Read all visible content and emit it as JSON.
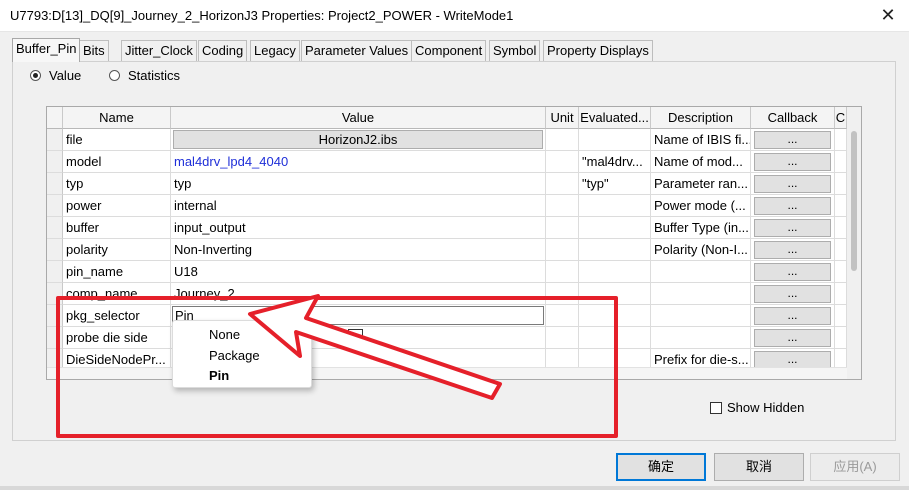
{
  "window": {
    "title": "U7793:D[13]_DQ[9]_Journey_2_HorizonJ3 Properties: Project2_POWER - WriteMode1",
    "close_icon": "close-icon"
  },
  "tabs": [
    {
      "label": "Buffer_Pin",
      "active": true
    },
    {
      "label": "Bits"
    },
    {
      "label": "Jitter_Clock"
    },
    {
      "label": "Coding"
    },
    {
      "label": "Legacy"
    },
    {
      "label": "Parameter Values"
    },
    {
      "label": "Component"
    },
    {
      "label": "Symbol"
    },
    {
      "label": "Property Displays"
    }
  ],
  "view_mode": {
    "value_label": "Value",
    "statistics_label": "Statistics",
    "selected": "Value"
  },
  "grid": {
    "columns": [
      "Name",
      "Value",
      "Unit",
      "Evaluated...",
      "Description",
      "Callback",
      "C"
    ],
    "rows": [
      {
        "name": "file",
        "value": "HorizonJ2.ibs",
        "value_kind": "button",
        "unit": "",
        "evaluated": "",
        "description": "Name of IBIS fi...",
        "callback": "..."
      },
      {
        "name": "model",
        "value": "mal4drv_lpd4_4040",
        "value_kind": "link",
        "unit": "",
        "evaluated": "\"mal4drv...",
        "description": "Name of mod...",
        "callback": "..."
      },
      {
        "name": "typ",
        "value": "typ",
        "value_kind": "text",
        "unit": "",
        "evaluated": "\"typ\"",
        "description": "Parameter ran...",
        "callback": "..."
      },
      {
        "name": "power",
        "value": "internal",
        "value_kind": "text",
        "unit": "",
        "evaluated": "",
        "description": "Power mode (...",
        "callback": "..."
      },
      {
        "name": "buffer",
        "value": "input_output",
        "value_kind": "text",
        "unit": "",
        "evaluated": "",
        "description": "Buffer Type (in...",
        "callback": "..."
      },
      {
        "name": "polarity",
        "value": "Non-Inverting",
        "value_kind": "text",
        "unit": "",
        "evaluated": "",
        "description": "Polarity (Non-I...",
        "callback": "..."
      },
      {
        "name": "pin_name",
        "value": "U18",
        "value_kind": "text",
        "unit": "",
        "evaluated": "",
        "description": "",
        "callback": "..."
      },
      {
        "name": "comp_name",
        "value": "Journey_2",
        "value_kind": "text",
        "unit": "",
        "evaluated": "",
        "description": "",
        "callback": "..."
      },
      {
        "name": "pkg_selector",
        "value": "Pin",
        "value_kind": "edit",
        "unit": "",
        "evaluated": "",
        "description": "",
        "callback": "..."
      },
      {
        "name": "probe die side",
        "value": "",
        "value_kind": "checkbox",
        "unit": "",
        "evaluated": "",
        "description": "",
        "callback": "..."
      },
      {
        "name": "DieSideNodePr...",
        "value": "",
        "value_kind": "text",
        "unit": "",
        "evaluated": "",
        "description": "Prefix for die-s...",
        "callback": "..."
      }
    ]
  },
  "dropdown": {
    "options": [
      "None",
      "Package",
      "Pin"
    ],
    "selected": "Pin"
  },
  "show_hidden": {
    "label": "Show Hidden",
    "checked": false
  },
  "footer": {
    "ok_label": "确定",
    "cancel_label": "取消",
    "apply_label": "应用(A)"
  },
  "annotation": {
    "color": "#e5202a"
  }
}
